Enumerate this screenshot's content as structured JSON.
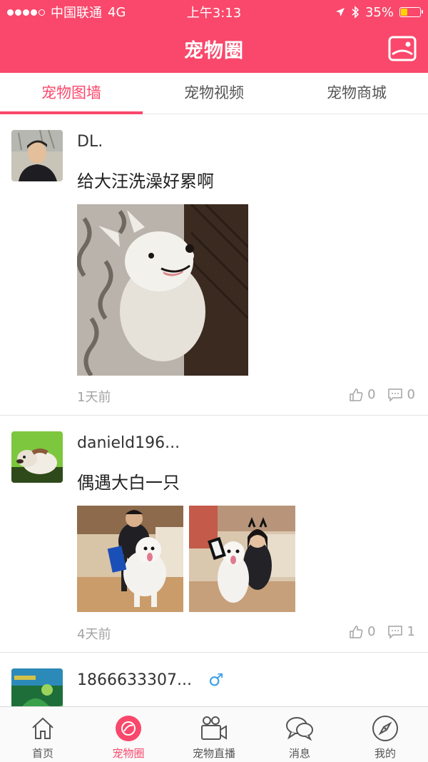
{
  "status_bar": {
    "carrier": "中国联通",
    "network": "4G",
    "time": "上午3:13",
    "battery": "35%",
    "battery_level": 0.35
  },
  "header": {
    "title": "宠物圈"
  },
  "tabs": [
    {
      "label": "宠物图墙",
      "active": true
    },
    {
      "label": "宠物视频",
      "active": false
    },
    {
      "label": "宠物商城",
      "active": false
    }
  ],
  "posts": [
    {
      "username": "DL.",
      "text": "给大汪洗澡好累啊",
      "time": "1天前",
      "likes": "0",
      "comments": "0"
    },
    {
      "username": "danield196...",
      "text": "偶遇大白一只",
      "time": "4天前",
      "likes": "0",
      "comments": "1"
    },
    {
      "username": "1866633307...",
      "gender": "♂"
    }
  ],
  "tab_bar": [
    {
      "label": "首页",
      "icon": "home-icon",
      "active": false
    },
    {
      "label": "宠物圈",
      "icon": "pet-circle-icon",
      "active": true
    },
    {
      "label": "宠物直播",
      "icon": "video-camera-icon",
      "active": false
    },
    {
      "label": "消息",
      "icon": "chat-bubbles-icon",
      "active": false
    },
    {
      "label": "我的",
      "icon": "compass-icon",
      "active": false
    }
  ],
  "colors": {
    "accent": "#f9486b",
    "gender_male": "#3a9fe8",
    "muted_text": "#a3a3a3"
  }
}
